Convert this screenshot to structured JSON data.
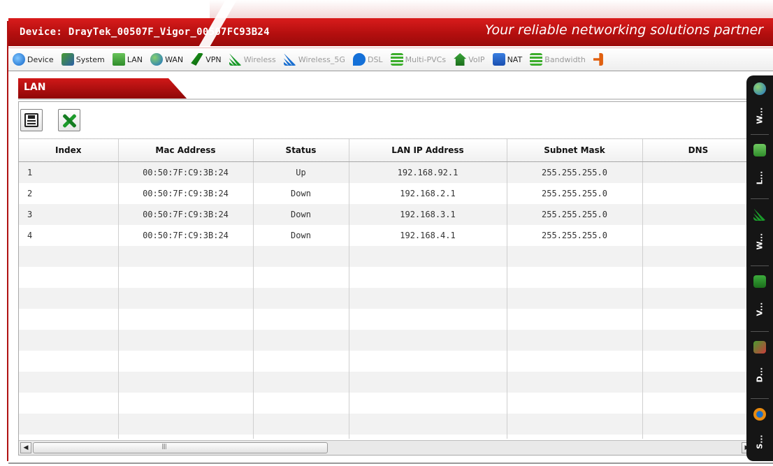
{
  "header": {
    "device_title": "Device: DrayTek_00507F_Vigor_00507FC93B24",
    "slogan": "Your reliable networking solutions partner"
  },
  "menu": [
    {
      "label": "Device",
      "icon": "globe-icon",
      "enabled": true
    },
    {
      "label": "System",
      "icon": "system-icon",
      "enabled": true
    },
    {
      "label": "LAN",
      "icon": "lan-monitor-icon",
      "enabled": true
    },
    {
      "label": "WAN",
      "icon": "wan-globe-icon",
      "enabled": true
    },
    {
      "label": "VPN",
      "icon": "vpn-icon",
      "enabled": true
    },
    {
      "label": "Wireless",
      "icon": "wireless-icon",
      "enabled": false
    },
    {
      "label": "Wireless_5G",
      "icon": "wireless-5g-icon",
      "enabled": false
    },
    {
      "label": "DSL",
      "icon": "dsl-icon",
      "enabled": false
    },
    {
      "label": "Multi-PVCs",
      "icon": "multi-pvcs-icon",
      "enabled": false
    },
    {
      "label": "VoIP",
      "icon": "voip-icon",
      "enabled": false
    },
    {
      "label": "NAT",
      "icon": "nat-icon",
      "enabled": true
    },
    {
      "label": "Bandwidth",
      "icon": "bandwidth-icon",
      "enabled": false
    },
    {
      "label": "",
      "icon": "more-icon",
      "enabled": true
    }
  ],
  "tab": {
    "label": "LAN"
  },
  "table": {
    "columns": [
      "Index",
      "Mac Address",
      "Status",
      "LAN IP Address",
      "Subnet Mask",
      "DNS"
    ],
    "rows": [
      [
        "1",
        "00:50:7F:C9:3B:24",
        "Up",
        "192.168.92.1",
        "255.255.255.0",
        ""
      ],
      [
        "2",
        "00:50:7F:C9:3B:24",
        "Down",
        "192.168.2.1",
        "255.255.255.0",
        ""
      ],
      [
        "3",
        "00:50:7F:C9:3B:24",
        "Down",
        "192.168.3.1",
        "255.255.255.0",
        ""
      ],
      [
        "4",
        "00:50:7F:C9:3B:24",
        "Down",
        "192.168.4.1",
        "255.255.255.0",
        ""
      ],
      [
        "",
        "",
        "",
        "",
        "",
        ""
      ],
      [
        "",
        "",
        "",
        "",
        "",
        ""
      ],
      [
        "",
        "",
        "",
        "",
        "",
        ""
      ],
      [
        "",
        "",
        "",
        "",
        "",
        ""
      ],
      [
        "",
        "",
        "",
        "",
        "",
        ""
      ],
      [
        "",
        "",
        "",
        "",
        "",
        ""
      ],
      [
        "",
        "",
        "",
        "",
        "",
        ""
      ],
      [
        "",
        "",
        "",
        "",
        "",
        ""
      ],
      [
        "",
        "",
        "",
        "",
        "",
        ""
      ],
      [
        "",
        "",
        "",
        "",
        "",
        ""
      ]
    ]
  },
  "sidebar": [
    {
      "label": "W...",
      "icon": "wan-globe-icon"
    },
    {
      "label": "L...",
      "icon": "lan-monitor-icon"
    },
    {
      "label": "W...",
      "icon": "wireless-icon"
    },
    {
      "label": "V...",
      "icon": "voip-phone-icon"
    },
    {
      "label": "D...",
      "icon": "device-icon"
    },
    {
      "label": "S...",
      "icon": "system-icon"
    }
  ],
  "colors": {
    "brand_red": "#c41414",
    "menu_bg": "#f2f2f2",
    "sidebar_bg": "#151515"
  }
}
